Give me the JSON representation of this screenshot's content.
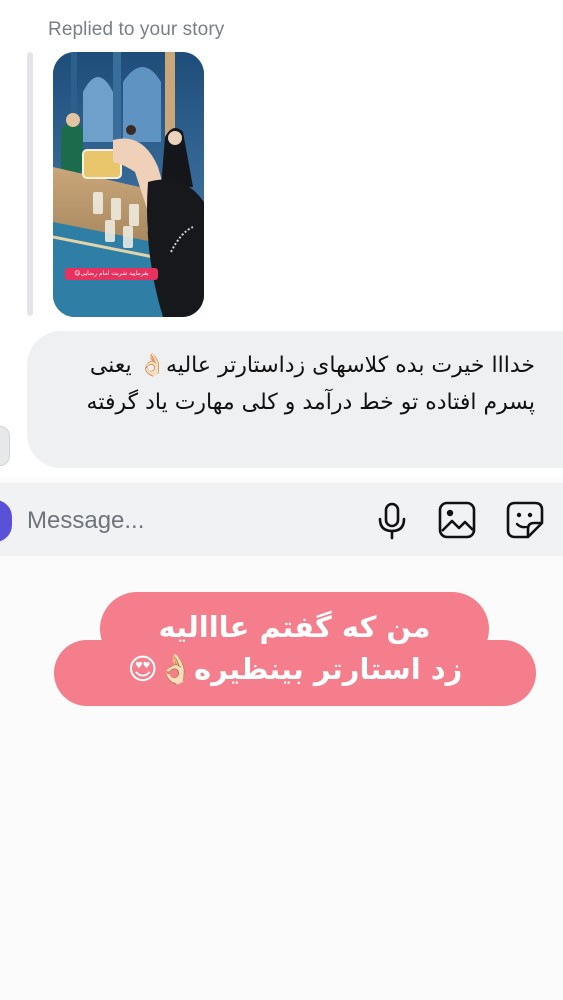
{
  "reply_header": {
    "caption": "Replied to your story"
  },
  "story": {
    "sticker_text": "بفرمایید شربت امام رضایی😋"
  },
  "received_message": {
    "text": "خدااا خیرت بده کلاسهای زداستارتر عالیه👌🏻 یعنی پسرم افتاده تو خط درآمد و کلی مهارت یاد گرفته"
  },
  "composer": {
    "placeholder": "Message...",
    "icons": [
      "microphone-icon",
      "gallery-icon",
      "sticker-icon"
    ]
  },
  "overlay_caption": {
    "line1": "من که گفتم عاااليه",
    "line2": "زد استارتر بينظيره👌🏻😍",
    "pill_color": "#f47e8b"
  },
  "colors": {
    "accent_camera": "#5b51d8",
    "bubble_bg": "#eff0f2"
  }
}
